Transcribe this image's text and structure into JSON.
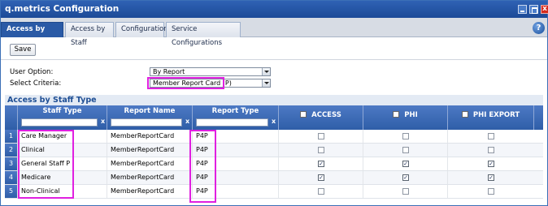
{
  "window": {
    "title": "q.metrics Configuration",
    "close_glyph": "x"
  },
  "tabs": [
    {
      "label": "Access by Staff Type",
      "active": true
    },
    {
      "label": "Access by Staff",
      "active": false
    },
    {
      "label": "Configurations",
      "active": false
    },
    {
      "label": "Service Configurations",
      "active": false
    }
  ],
  "toolbar": {
    "save_label": "Save"
  },
  "criteria": {
    "user_option_label": "User Option:",
    "user_option_value": "By Report",
    "select_criteria_label": "Select Criteria:",
    "select_criteria_value": "Member Report Card (P)"
  },
  "section": {
    "title": "Access by Staff Type"
  },
  "grid": {
    "columns": {
      "staff_type": "Staff Type",
      "report_name": "Report Name",
      "report_type": "Report Type",
      "access": "ACCESS",
      "phi": "PHI",
      "phi_export": "PHI EXPORT"
    },
    "filter_clear": "x",
    "rows": [
      {
        "num": "1",
        "staff_type": "Care Manager",
        "report_name": "MemberReportCard",
        "report_type": "P4P",
        "access": false,
        "phi": false,
        "phi_export": false
      },
      {
        "num": "2",
        "staff_type": "Clinical",
        "report_name": "MemberReportCard",
        "report_type": "P4P",
        "access": false,
        "phi": false,
        "phi_export": false
      },
      {
        "num": "3",
        "staff_type": "General Staff P",
        "report_name": "MemberReportCard",
        "report_type": "P4P",
        "access": true,
        "phi": true,
        "phi_export": true
      },
      {
        "num": "4",
        "staff_type": "Medicare",
        "report_name": "MemberReportCard",
        "report_type": "P4P",
        "access": true,
        "phi": true,
        "phi_export": true
      },
      {
        "num": "5",
        "staff_type": "Non-Clinical",
        "report_name": "MemberReportCard",
        "report_type": "P4P",
        "access": false,
        "phi": false,
        "phi_export": false
      }
    ]
  },
  "colors": {
    "accent": "#2f5ea8",
    "highlight": "#e020e0",
    "close": "#d52b1e"
  },
  "icons": {
    "help": "help-icon",
    "minimize": "minimize-icon",
    "maximize": "maximize-icon",
    "close": "close-icon"
  }
}
